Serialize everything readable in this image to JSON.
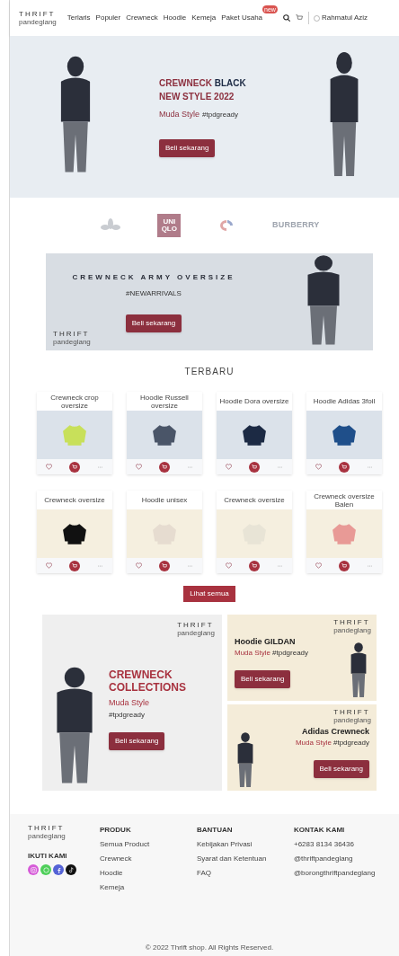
{
  "header": {
    "logo": {
      "title": "THRIFT",
      "subtitle": "pandeglang"
    },
    "nav": [
      {
        "label": "Terlaris"
      },
      {
        "label": "Populer"
      },
      {
        "label": "Crewneck"
      },
      {
        "label": "Hoodie"
      },
      {
        "label": "Kemeja"
      },
      {
        "label": "Paket Usaha",
        "badge": "new"
      }
    ],
    "account": "Rahmatul Aziz"
  },
  "hero": {
    "title_accent": "CREWNECK",
    "title_rest": "BLACK",
    "title_line2": "NEW STYLE 2022",
    "subtitle": "Muda Style",
    "tag": "#tpdgready",
    "button": "Beli sekarang"
  },
  "brands": [
    {
      "kind": "adidas"
    },
    {
      "kind": "uniqlo",
      "text": "UNI QLO"
    },
    {
      "kind": "champion"
    },
    {
      "kind": "wordmark",
      "text": "BURBERRY"
    }
  ],
  "promo": {
    "title": "CREWNECK ARMY OVERSIZE",
    "tag": "#NEWARRIVALS",
    "button": "Beli sekarang",
    "logo": {
      "title": "THRIFT",
      "subtitle": "pandeglang"
    }
  },
  "section_title": "TERBARU",
  "products": [
    {
      "name": "Crewneck crop oversize",
      "color": "#c8e05a"
    },
    {
      "name": "Hoodie Russell oversize",
      "color": "#4a5568"
    },
    {
      "name": "Hoodie Dora oversize",
      "color": "#1c2a44"
    },
    {
      "name": "Hoodie Adidas 3foil",
      "color": "#1f4f8a"
    },
    {
      "name": "Crewneck oversize",
      "color": "#111111"
    },
    {
      "name": "Hoodie unisex",
      "color": "#e6dcd0"
    },
    {
      "name": "Crewneck oversize",
      "color": "#e8e4d6"
    },
    {
      "name": "Crewneck oversize Balen",
      "color": "#e89a96"
    }
  ],
  "see_all": "Lihat semua",
  "collage": {
    "main": {
      "title": "CREWNECK COLLECTIONS",
      "subtitle": "Muda Style",
      "tag": "#tpdgready",
      "button": "Beli sekarang",
      "logo": {
        "title": "THRIFT",
        "subtitle": "pandeglang"
      }
    },
    "side": [
      {
        "title": "Hoodie GILDAN",
        "subtitle": "Muda Style",
        "tag": "#tpdgready",
        "button": "Beli sekarang",
        "logo": {
          "title": "THRIFT",
          "subtitle": "pandeglang"
        }
      },
      {
        "title": "Adidas Crewneck",
        "subtitle": "Muda Style",
        "tag": "#tpdgready",
        "button": "Beli sekarang",
        "logo": {
          "title": "THRIFT",
          "subtitle": "pandeglang"
        }
      }
    ]
  },
  "footer": {
    "logo": {
      "title": "THRIFT",
      "subtitle": "pandeglang"
    },
    "follow": "IKUTI KAMI",
    "socials": [
      {
        "kind": "instagram",
        "color": "#d65bd8"
      },
      {
        "kind": "whatsapp",
        "color": "#4fcf5a"
      },
      {
        "kind": "facebook",
        "color": "#5563d6"
      },
      {
        "kind": "tiktok",
        "color": "#111111"
      }
    ],
    "columns": [
      {
        "title": "PRODUK",
        "links": [
          "Semua Product",
          "Crewneck",
          "Hoodie",
          "Kemeja"
        ]
      },
      {
        "title": "BANTUAN",
        "links": [
          "Kebijakan Privasi",
          "Syarat dan Ketentuan",
          "FAQ"
        ]
      },
      {
        "title": "KONTAK KAMI",
        "links": [
          "+6283 8134 36436",
          "@thriftpandeglang",
          "@borongthriftpandeglang"
        ]
      }
    ],
    "copyright": "© 2022 Thrift shop. All Rights Reserved."
  }
}
